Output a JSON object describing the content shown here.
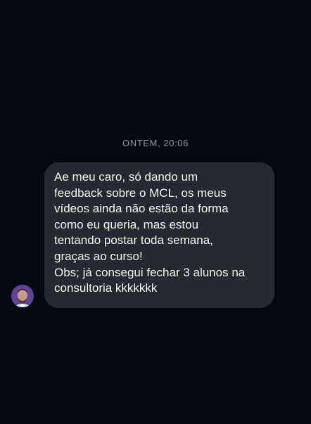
{
  "conversation": {
    "timestamp": "ONTEM, 20:06",
    "message": {
      "sender_avatar_icon": "user-avatar-icon",
      "lines": [
        "Ae meu caro, só dando um",
        "feedback sobre o MCL, os meus",
        "vídeos ainda não estão da forma",
        "como eu queria, mas estou",
        "tentando postar toda semana,",
        "graças ao curso!",
        "Obs; já consegui fechar 3 alunos na",
        "consultoria kkkkkkk"
      ]
    }
  },
  "colors": {
    "background": "#040811",
    "bubble": "#262a30",
    "text": "#f3f4f6",
    "timestamp": "#8e939c"
  }
}
